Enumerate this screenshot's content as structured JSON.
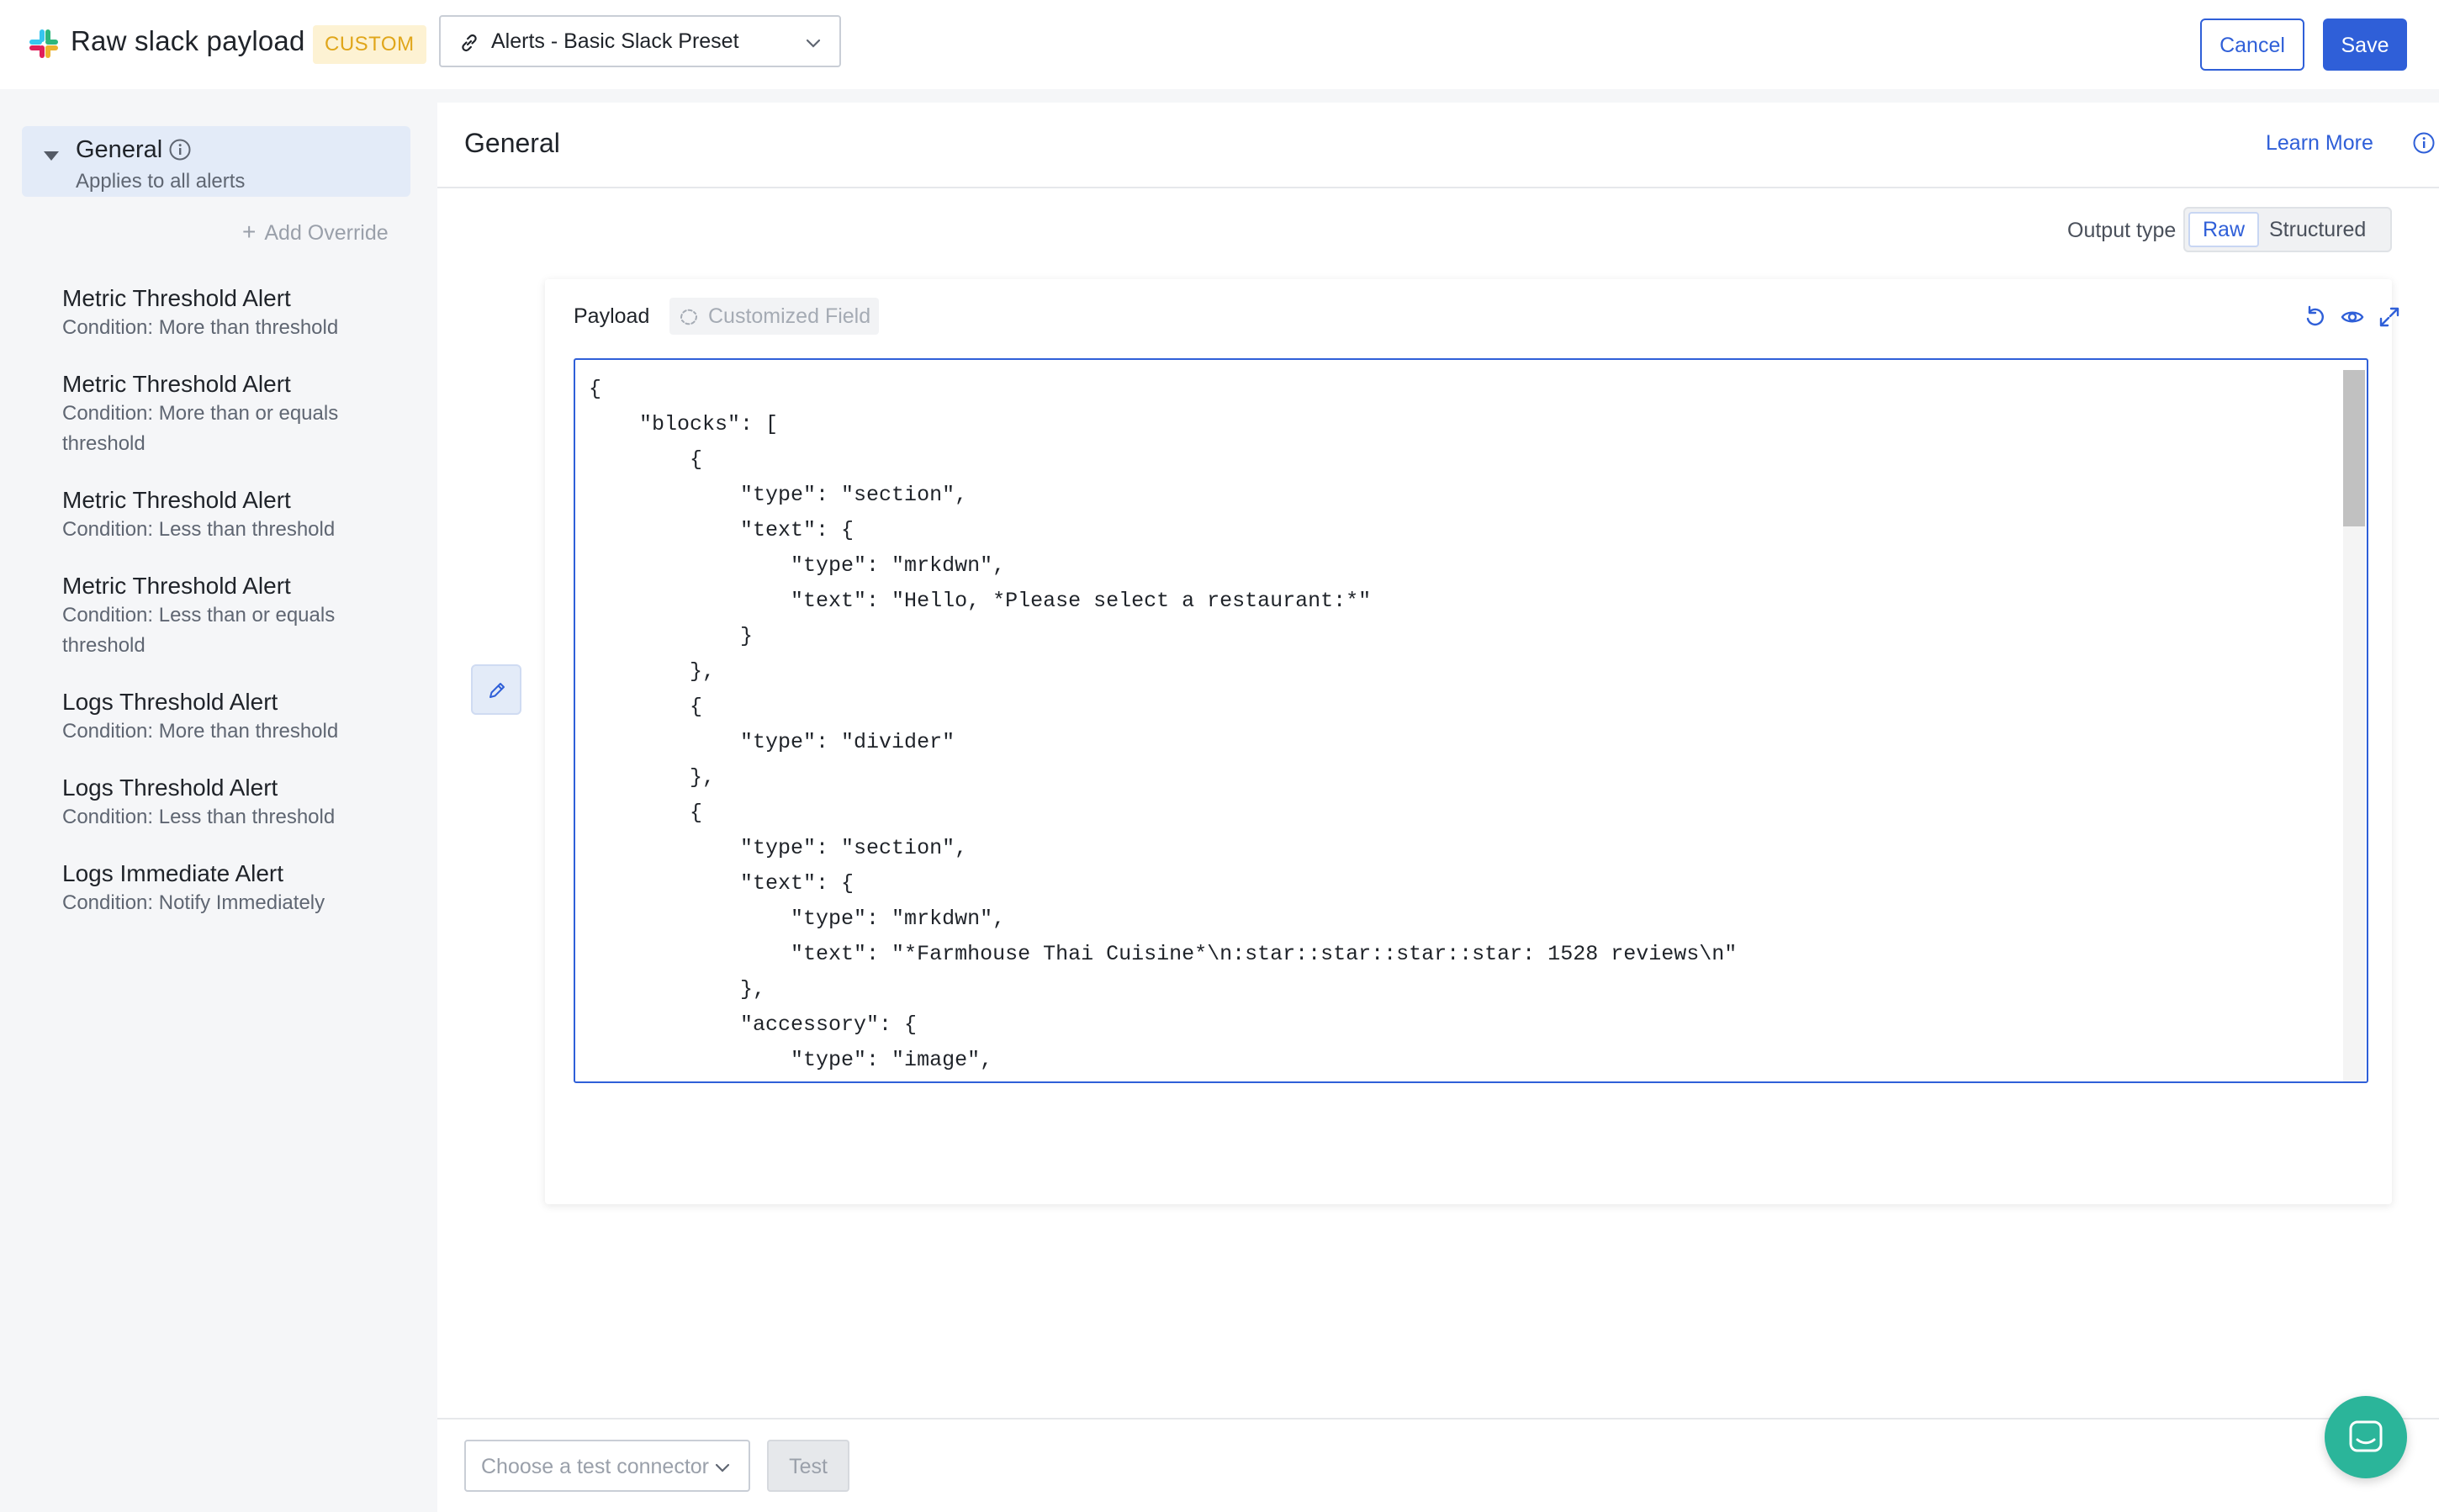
{
  "app": {
    "title": "Raw slack payload",
    "badge": "CUSTOM",
    "preset": "Alerts - Basic Slack Preset",
    "cancel_label": "Cancel",
    "save_label": "Save"
  },
  "sidebar": {
    "general": {
      "title": "General",
      "subtitle": "Applies to all alerts"
    },
    "add_override_label": "Add Override",
    "items": [
      {
        "title": "Metric Threshold Alert",
        "condition": "Condition: More than threshold"
      },
      {
        "title": "Metric Threshold Alert",
        "condition": "Condition: More than or equals threshold"
      },
      {
        "title": "Metric Threshold Alert",
        "condition": "Condition: Less than threshold"
      },
      {
        "title": "Metric Threshold Alert",
        "condition": "Condition: Less than or equals threshold"
      },
      {
        "title": "Logs Threshold Alert",
        "condition": "Condition: More than threshold"
      },
      {
        "title": "Logs Threshold Alert",
        "condition": "Condition: Less than threshold"
      },
      {
        "title": "Logs Immediate Alert",
        "condition": "Condition: Notify Immediately"
      }
    ]
  },
  "main": {
    "title": "General",
    "learn_more_label": "Learn More",
    "output_type_label": "Output type",
    "output_options": [
      "Raw",
      "Structured"
    ],
    "output_selected": "Raw",
    "payload_label": "Payload",
    "customized_field_label": "Customized Field",
    "code_lines": [
      "{",
      "    \"blocks\": [",
      "        {",
      "            \"type\": \"section\",",
      "            \"text\": {",
      "                \"type\": \"mrkdwn\",",
      "                \"text\": \"Hello, *Please select a restaurant:*\"",
      "            }",
      "        },",
      "        {",
      "            \"type\": \"divider\"",
      "        },",
      "        {",
      "            \"type\": \"section\",",
      "            \"text\": {",
      "                \"type\": \"mrkdwn\",",
      "                \"text\": \"*Farmhouse Thai Cuisine*\\n:star::star::star::star: 1528 reviews\\n\"",
      "            },",
      "            \"accessory\": {",
      "                \"type\": \"image\","
    ],
    "connector_placeholder": "Choose a test connector",
    "test_label": "Test"
  },
  "colors": {
    "accent": "#2f5fd8",
    "badge_bg": "#fdf2d3",
    "badge_text": "#e0a61a",
    "chat_fab": "#2bb59a"
  },
  "icons": [
    "slack-logo",
    "link-icon",
    "chevron-down-icon",
    "info-icon",
    "plus-icon",
    "edit-icon",
    "customized-field-icon",
    "undo-icon",
    "eye-icon",
    "expand-icon",
    "chat-icon"
  ]
}
